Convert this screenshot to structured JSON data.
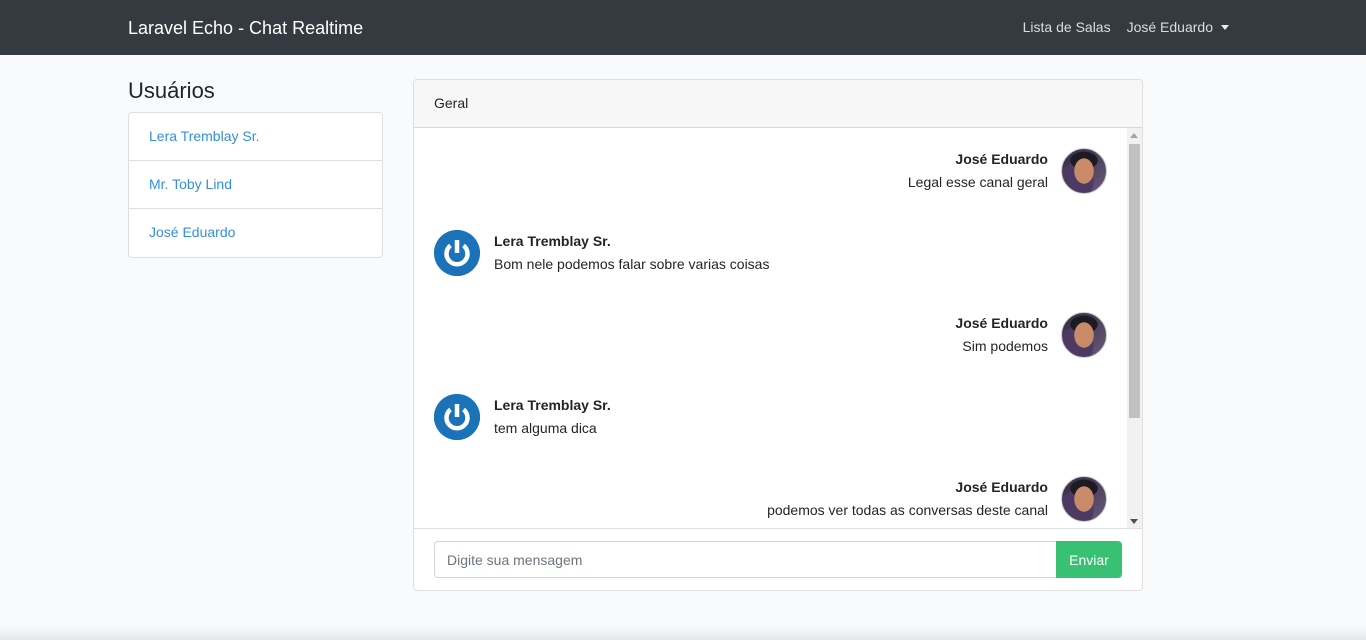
{
  "navbar": {
    "brand": "Laravel Echo - Chat Realtime",
    "rooms_link": "Lista de Salas",
    "user_menu": "José Eduardo"
  },
  "sidebar": {
    "title": "Usuários",
    "users": [
      {
        "name": "Lera Tremblay Sr."
      },
      {
        "name": "Mr. Toby Lind"
      },
      {
        "name": "José Eduardo"
      }
    ]
  },
  "chat": {
    "channel": "Geral",
    "messages": [
      {
        "author": "José Eduardo",
        "text": "Legal esse canal geral",
        "side": "right"
      },
      {
        "author": "Lera Tremblay Sr.",
        "text": "Bom nele podemos falar sobre varias coisas",
        "side": "left"
      },
      {
        "author": "José Eduardo",
        "text": "Sim podemos",
        "side": "right"
      },
      {
        "author": "Lera Tremblay Sr.",
        "text": "tem alguma dica",
        "side": "left"
      },
      {
        "author": "José Eduardo",
        "text": "podemos ver todas as conversas deste canal",
        "side": "right"
      }
    ],
    "composer": {
      "placeholder": "Digite sua mensagem",
      "value": "",
      "send_label": "Enviar"
    }
  },
  "colors": {
    "navbar": "#343a40",
    "link": "#3490dc",
    "send_button": "#38c172",
    "power_avatar": "#1a73b9"
  }
}
